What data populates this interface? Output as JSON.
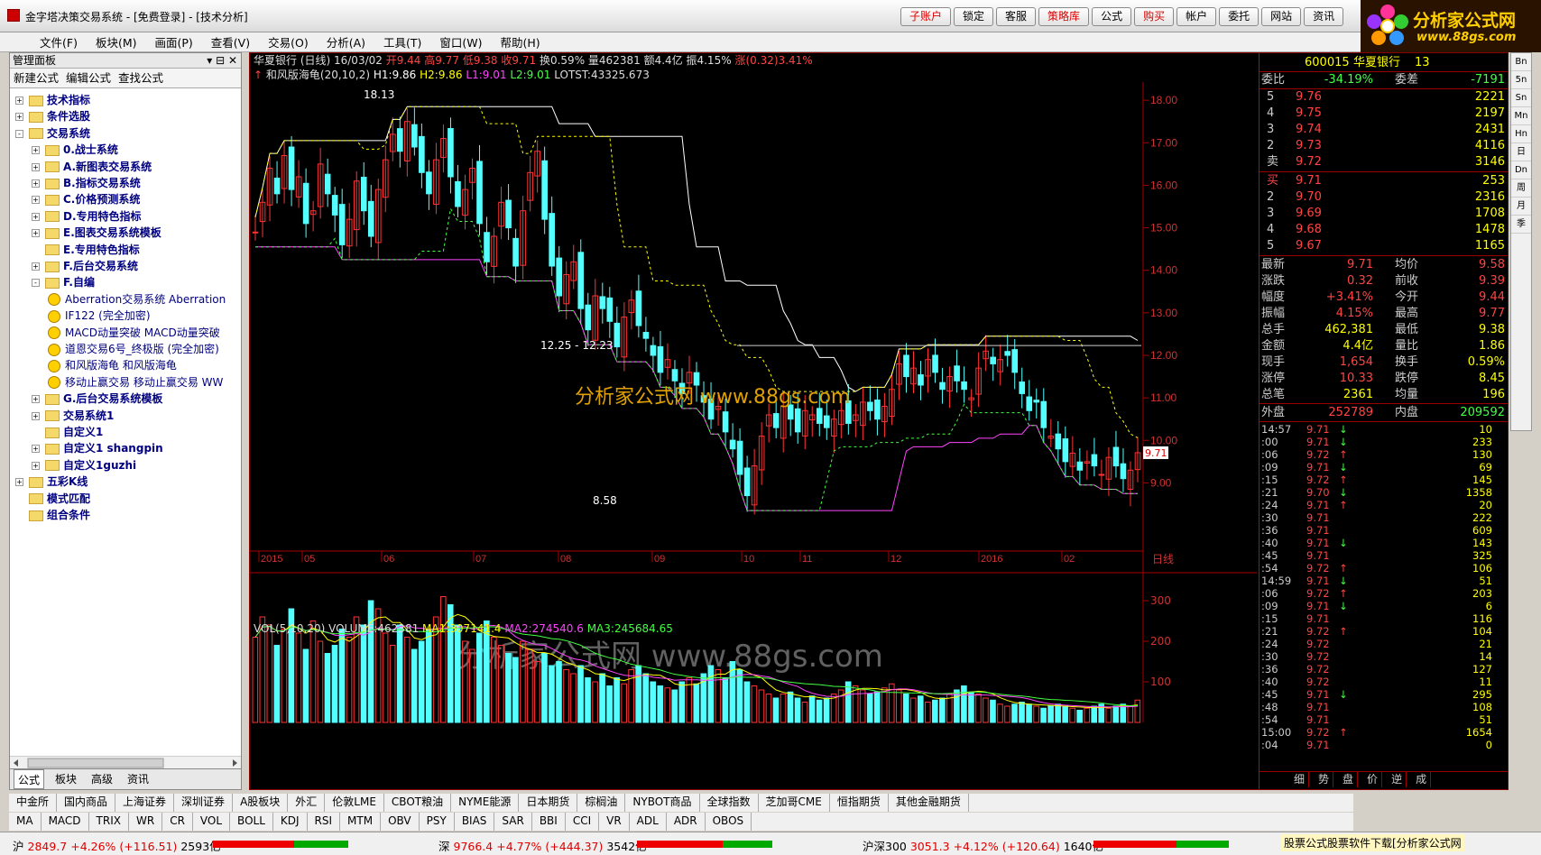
{
  "window": {
    "title": "金字塔决策交易系统 - [免费登录] - [技术分析]"
  },
  "top_buttons": [
    {
      "label": "子账户",
      "red": true
    },
    {
      "label": "锁定",
      "red": false
    },
    {
      "label": "客服",
      "red": false
    },
    {
      "label": "策略库",
      "red": true
    },
    {
      "label": "公式",
      "red": false
    },
    {
      "label": "购买",
      "red": true
    },
    {
      "label": "帐户",
      "red": false
    },
    {
      "label": "委托",
      "red": false
    },
    {
      "label": "网站",
      "red": false
    },
    {
      "label": "资讯",
      "red": false
    }
  ],
  "logo": {
    "line1": "分析家公式网",
    "line2": "www.88gs.com"
  },
  "menu": [
    "文件(F)",
    "板块(M)",
    "画面(P)",
    "查看(V)",
    "交易(O)",
    "分析(A)",
    "工具(T)",
    "窗口(W)",
    "帮助(H)"
  ],
  "left_panel": {
    "title": "管理面板",
    "toolbar": [
      "新建公式",
      "编辑公式",
      "查找公式"
    ],
    "tree": [
      {
        "label": "技术指标",
        "level": 0,
        "type": "folder",
        "exp": "+"
      },
      {
        "label": "条件选股",
        "level": 0,
        "type": "folder",
        "exp": "+"
      },
      {
        "label": "交易系统",
        "level": 0,
        "type": "folder",
        "exp": "-"
      },
      {
        "label": "0.战士系统",
        "level": 1,
        "type": "folder",
        "exp": "+"
      },
      {
        "label": "A.新图表交易系统",
        "level": 1,
        "type": "folder",
        "exp": "+"
      },
      {
        "label": "B.指标交易系统",
        "level": 1,
        "type": "folder",
        "exp": "+"
      },
      {
        "label": "C.价格预测系统",
        "level": 1,
        "type": "folder",
        "exp": "+"
      },
      {
        "label": "D.专用特色指标",
        "level": 1,
        "type": "folder",
        "exp": "+"
      },
      {
        "label": "E.图表交易系统模板",
        "level": 1,
        "type": "folder",
        "exp": "+"
      },
      {
        "label": "E.专用特色指标",
        "level": 1,
        "type": "folder",
        "exp": ""
      },
      {
        "label": "F.后台交易系统",
        "level": 1,
        "type": "folder",
        "exp": "+"
      },
      {
        "label": "F.自编",
        "level": 1,
        "type": "folder",
        "exp": "-"
      },
      {
        "label": "Aberration交易系统 Aberration",
        "level": 2,
        "type": "formula"
      },
      {
        "label": "IF122 (完全加密)",
        "level": 2,
        "type": "formula"
      },
      {
        "label": "MACD动量突破 MACD动量突破",
        "level": 2,
        "type": "formula"
      },
      {
        "label": "道恩交易6号_终极版 (完全加密)",
        "level": 2,
        "type": "formula"
      },
      {
        "label": "和风版海龟 和风版海龟",
        "level": 2,
        "type": "formula"
      },
      {
        "label": "移动止赢交易 移动止赢交易 WW",
        "level": 2,
        "type": "formula"
      },
      {
        "label": "G.后台交易系统模板",
        "level": 1,
        "type": "folder",
        "exp": "+"
      },
      {
        "label": "交易系统1",
        "level": 1,
        "type": "folder",
        "exp": "+"
      },
      {
        "label": "自定义1",
        "level": 1,
        "type": "folder",
        "exp": ""
      },
      {
        "label": "自定义1 shangpin",
        "level": 1,
        "type": "folder",
        "exp": "+"
      },
      {
        "label": "自定义1guzhi",
        "level": 1,
        "type": "folder",
        "exp": "+"
      },
      {
        "label": "五彩K线",
        "level": 0,
        "type": "folder",
        "exp": "+"
      },
      {
        "label": "模式匹配",
        "level": 0,
        "type": "folder",
        "exp": ""
      },
      {
        "label": "组合条件",
        "level": 0,
        "type": "folder",
        "exp": ""
      }
    ],
    "tabs": [
      "公式",
      "板块",
      "高级",
      "资讯"
    ]
  },
  "chart_info": {
    "stock": "华夏银行 (日线) 16/03/02",
    "open": "开9.44",
    "high": "高9.77",
    "low": "低9.38",
    "close": "收9.71",
    "turnover": "换0.59%",
    "volume": "量462381",
    "amount": "额4.4亿",
    "amplitude": "振4.15%",
    "change": "涨(0.32)3.41%",
    "indicator": "和风版海龟(20,10,2)",
    "h1": "H1:9.86",
    "h2": "H2:9.86",
    "l1": "L1:9.01",
    "l2": "L2:9.01",
    "lotst": "LOTST:43325.673"
  },
  "vol_info": {
    "label": "VOL(5,10,20) VOLUME:462381",
    "ma1": "MA1:307141.4",
    "ma2": "MA2:274540.6",
    "ma3": "MA3:245684.65"
  },
  "watermark": "分析家公式网 www.88gs.com",
  "annotations": {
    "hi": "18.13",
    "lo": "8.58",
    "range": "12.25 - 12.23",
    "last": "9.71"
  },
  "chart_data": {
    "type": "candlestick",
    "y_ticks": [
      "18.00",
      "17.00",
      "16.00",
      "15.00",
      "14.00",
      "13.00",
      "12.00",
      "11.00",
      "10.00",
      "9.00"
    ],
    "x_ticks": [
      "2015",
      "05",
      "06",
      "07",
      "08",
      "09",
      "10",
      "11",
      "12",
      "2016",
      "02"
    ],
    "period_label": "日线",
    "vol_ticks": [
      "300",
      "200",
      "100"
    ],
    "close_series": [
      14.9,
      15.6,
      16.4,
      15.8,
      16.7,
      15.9,
      16.2,
      15.1,
      15.4,
      16.5,
      15.8,
      15.3,
      14.6,
      15.2,
      16.1,
      15.4,
      14.8,
      15.9,
      16.6,
      17.2,
      16.8,
      17.5,
      16.9,
      16.3,
      15.8,
      16.6,
      17.1,
      16.2,
      15.5,
      15.9,
      16.4,
      15.1,
      14.2,
      14.8,
      15.6,
      15.0,
      14.1,
      15.4,
      16.3,
      16.8,
      15.2,
      14.1,
      13.4,
      13.9,
      14.2,
      13.1,
      12.6,
      13.4,
      13.1,
      12.8,
      12.2,
      12.9,
      13.3,
      12.7,
      12.4,
      12.0,
      11.6,
      11.9,
      11.4,
      11.1,
      11.6,
      11.3,
      10.9,
      10.5,
      10.8,
      10.2,
      9.8,
      9.2,
      8.7,
      9.4,
      10.1,
      10.6,
      10.3,
      10.8,
      10.5,
      10.2,
      10.7,
      10.6,
      10.4,
      10.3,
      10.5,
      10.7,
      10.4,
      10.6,
      10.9,
      10.7,
      10.5,
      10.8,
      11.2,
      11.8,
      11.5,
      11.7,
      11.3,
      11.9,
      11.6,
      11.2,
      11.5,
      11.4,
      11.2,
      11.0,
      11.7,
      12.1,
      11.8,
      11.9,
      12.0,
      11.6,
      11.1,
      10.7,
      10.9,
      10.3,
      10.1,
      9.8,
      9.5,
      9.7,
      9.3,
      9.5,
      9.4,
      9.2,
      9.6,
      9.4,
      9.1,
      9.3,
      9.71
    ],
    "volume_series": [
      210,
      260,
      240,
      190,
      230,
      280,
      220,
      180,
      250,
      200,
      170,
      190,
      230,
      210,
      260,
      240,
      300,
      280,
      220,
      190,
      240,
      210,
      180,
      200,
      230,
      260,
      310,
      290,
      240,
      200,
      180,
      220,
      250,
      210,
      190,
      170,
      160,
      200,
      180,
      150,
      170,
      140,
      150,
      130,
      120,
      140,
      110,
      100,
      120,
      90,
      110,
      95,
      130,
      140,
      120,
      100,
      90,
      85,
      80,
      100,
      110,
      95,
      120,
      140,
      130,
      110,
      150,
      130,
      100,
      90,
      80,
      70,
      60,
      70,
      75,
      60,
      50,
      65,
      55,
      60,
      70,
      80,
      100,
      90,
      80,
      70,
      75,
      85,
      95,
      80,
      70,
      60,
      65,
      50,
      55,
      60,
      70,
      80,
      90,
      75,
      70,
      60,
      55,
      45,
      40,
      45,
      50,
      45,
      40,
      35,
      40,
      45,
      40,
      35,
      30,
      35,
      40,
      45,
      35,
      40,
      45,
      40,
      55
    ]
  },
  "right_panel": {
    "code": "600015",
    "name": "华夏银行",
    "num": "13",
    "weibi": {
      "label": "委比",
      "value": "-34.19%",
      "label2": "委差",
      "value2": "-7191"
    },
    "asks": [
      {
        "n": "5",
        "p": "9.76",
        "v": "2221"
      },
      {
        "n": "4",
        "p": "9.75",
        "v": "2197"
      },
      {
        "n": "3",
        "p": "9.74",
        "v": "2431"
      },
      {
        "n": "2",
        "p": "9.73",
        "v": "4116"
      },
      {
        "n": "卖",
        "p": "9.72",
        "v": "3146"
      }
    ],
    "bids": [
      {
        "n": "买",
        "p": "9.71",
        "v": "253"
      },
      {
        "n": "2",
        "p": "9.70",
        "v": "2316"
      },
      {
        "n": "3",
        "p": "9.69",
        "v": "1708"
      },
      {
        "n": "4",
        "p": "9.68",
        "v": "1478"
      },
      {
        "n": "5",
        "p": "9.67",
        "v": "1165"
      }
    ],
    "stats": [
      {
        "k1": "最新",
        "v1": "9.71",
        "k2": "均价",
        "v2": "9.58"
      },
      {
        "k1": "涨跌",
        "v1": "0.32",
        "k2": "前收",
        "v2": "9.39"
      },
      {
        "k1": "幅度",
        "v1": "+3.41%",
        "k2": "今开",
        "v2": "9.44"
      },
      {
        "k1": "振幅",
        "v1": "4.15%",
        "k2": "最高",
        "v2": "9.77"
      },
      {
        "k1": "总手",
        "v1": "462,381",
        "k2": "最低",
        "v2": "9.38"
      },
      {
        "k1": "金额",
        "v1": "4.4亿",
        "k2": "量比",
        "v2": "1.86"
      },
      {
        "k1": "现手",
        "v1": "1,654",
        "k2": "换手",
        "v2": "0.59%"
      },
      {
        "k1": "涨停",
        "v1": "10.33",
        "k2": "跌停",
        "v2": "8.45"
      },
      {
        "k1": "总笔",
        "v1": "2361",
        "k2": "均量",
        "v2": "196"
      }
    ],
    "outer": {
      "k1": "外盘",
      "v1": "252789",
      "k2": "内盘",
      "v2": "209592"
    },
    "ticks": [
      {
        "t": "14:57",
        "p": "9.71",
        "v": "10",
        "d": "↓"
      },
      {
        "t": ":00",
        "p": "9.71",
        "v": "233",
        "d": "↓"
      },
      {
        "t": ":06",
        "p": "9.72",
        "v": "130",
        "d": "↑"
      },
      {
        "t": ":09",
        "p": "9.71",
        "v": "69",
        "d": "↓"
      },
      {
        "t": ":15",
        "p": "9.72",
        "v": "145",
        "d": "↑"
      },
      {
        "t": ":21",
        "p": "9.70",
        "v": "1358",
        "d": "↓"
      },
      {
        "t": ":24",
        "p": "9.71",
        "v": "20",
        "d": "↑"
      },
      {
        "t": ":30",
        "p": "9.71",
        "v": "222",
        "d": ""
      },
      {
        "t": ":36",
        "p": "9.71",
        "v": "609",
        "d": ""
      },
      {
        "t": ":40",
        "p": "9.71",
        "v": "143",
        "d": "↓"
      },
      {
        "t": ":45",
        "p": "9.71",
        "v": "325",
        "d": ""
      },
      {
        "t": ":54",
        "p": "9.72",
        "v": "106",
        "d": "↑"
      },
      {
        "t": "14:59",
        "p": "9.71",
        "v": "51",
        "d": "↓"
      },
      {
        "t": ":06",
        "p": "9.72",
        "v": "203",
        "d": "↑"
      },
      {
        "t": ":09",
        "p": "9.71",
        "v": "6",
        "d": "↓"
      },
      {
        "t": ":15",
        "p": "9.71",
        "v": "116",
        "d": ""
      },
      {
        "t": ":21",
        "p": "9.72",
        "v": "104",
        "d": "↑"
      },
      {
        "t": ":24",
        "p": "9.72",
        "v": "21",
        "d": ""
      },
      {
        "t": ":30",
        "p": "9.72",
        "v": "14",
        "d": ""
      },
      {
        "t": ":36",
        "p": "9.72",
        "v": "127",
        "d": ""
      },
      {
        "t": ":40",
        "p": "9.72",
        "v": "11",
        "d": ""
      },
      {
        "t": ":45",
        "p": "9.71",
        "v": "295",
        "d": "↓"
      },
      {
        "t": ":48",
        "p": "9.71",
        "v": "108",
        "d": ""
      },
      {
        "t": ":54",
        "p": "9.71",
        "v": "51",
        "d": ""
      },
      {
        "t": "15:00",
        "p": "9.72",
        "v": "1654",
        "d": "↑"
      },
      {
        "t": ":04",
        "p": "9.71",
        "v": "0",
        "d": ""
      }
    ],
    "bottom_tabs": [
      "细",
      "势",
      "盘",
      "价",
      "逆",
      "成"
    ]
  },
  "right_sidebar": [
    "Bn",
    "5n",
    "Sn",
    "Mn",
    "Hn",
    "日",
    "Dn",
    "周",
    "月",
    "季"
  ],
  "market_tabs": [
    "中金所",
    "国内商品",
    "上海证券",
    "深圳证券",
    "A股板块",
    "外汇",
    "伦敦LME",
    "CBOT粮油",
    "NYME能源",
    "日本期货",
    "棕榈油",
    "NYBOT商品",
    "全球指数",
    "芝加哥CME",
    "恒指期货",
    "其他金融期货"
  ],
  "indicator_tabs": [
    "MA",
    "MACD",
    "TRIX",
    "WR",
    "CR",
    "VOL",
    "BOLL",
    "KDJ",
    "RSI",
    "MTM",
    "OBV",
    "PSY",
    "BIAS",
    "SAR",
    "BBI",
    "CCI",
    "VR",
    "ADL",
    "ADR",
    "OBOS"
  ],
  "status": {
    "sh": {
      "label": "沪",
      "value": "2849.7",
      "chg": "+4.26%",
      "pts": "(+116.51)",
      "amt": "2593亿"
    },
    "sz": {
      "label": "深",
      "value": "9766.4",
      "chg": "+4.77%",
      "pts": "(+444.37)",
      "amt": "3542亿"
    },
    "hs300": {
      "label": "沪深300",
      "value": "3051.3",
      "chg": "+4.12%",
      "pts": "(+120.64)",
      "amt": "1640亿"
    },
    "promo": "股票公式股票软件下载[分析家公式网"
  },
  "colors": {
    "up": "#ff3333",
    "down": "#54ffff",
    "bg": "#000000",
    "grid": "#880000",
    "ma1": "#ffffff",
    "ma2": "#ff44ff",
    "ma3": "#ffff00"
  }
}
